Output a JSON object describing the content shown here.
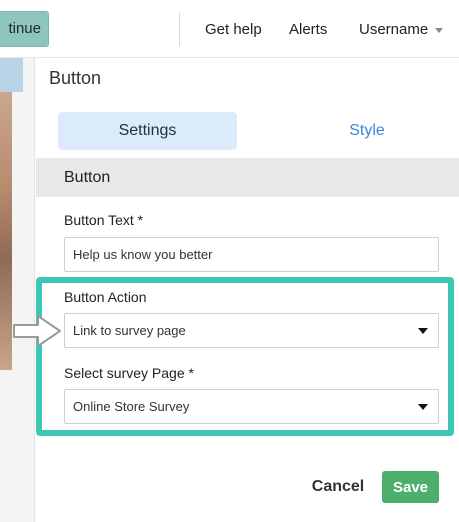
{
  "topbar": {
    "continue_label": "tinue",
    "get_help": "Get help",
    "alerts": "Alerts",
    "username": "Username"
  },
  "panel": {
    "title": "Button",
    "tabs": [
      {
        "label": "Settings",
        "active": true
      },
      {
        "label": "Style",
        "active": false
      }
    ],
    "section_title": "Button",
    "fields": {
      "button_text": {
        "label": "Button Text *",
        "value": "Help us know you better"
      },
      "button_action": {
        "label": "Button Action",
        "selected": "Link to survey page"
      },
      "survey_page": {
        "label": "Select survey Page *",
        "selected": "Online Store Survey"
      }
    },
    "actions": {
      "cancel": "Cancel",
      "save": "Save"
    }
  },
  "colors": {
    "accent_teal": "#3dc7b5",
    "save_green": "#4caf6e",
    "tab_active_bg": "#dcebfb",
    "tab_link_blue": "#3a86d8",
    "continue_bg": "#8fc5bd"
  }
}
